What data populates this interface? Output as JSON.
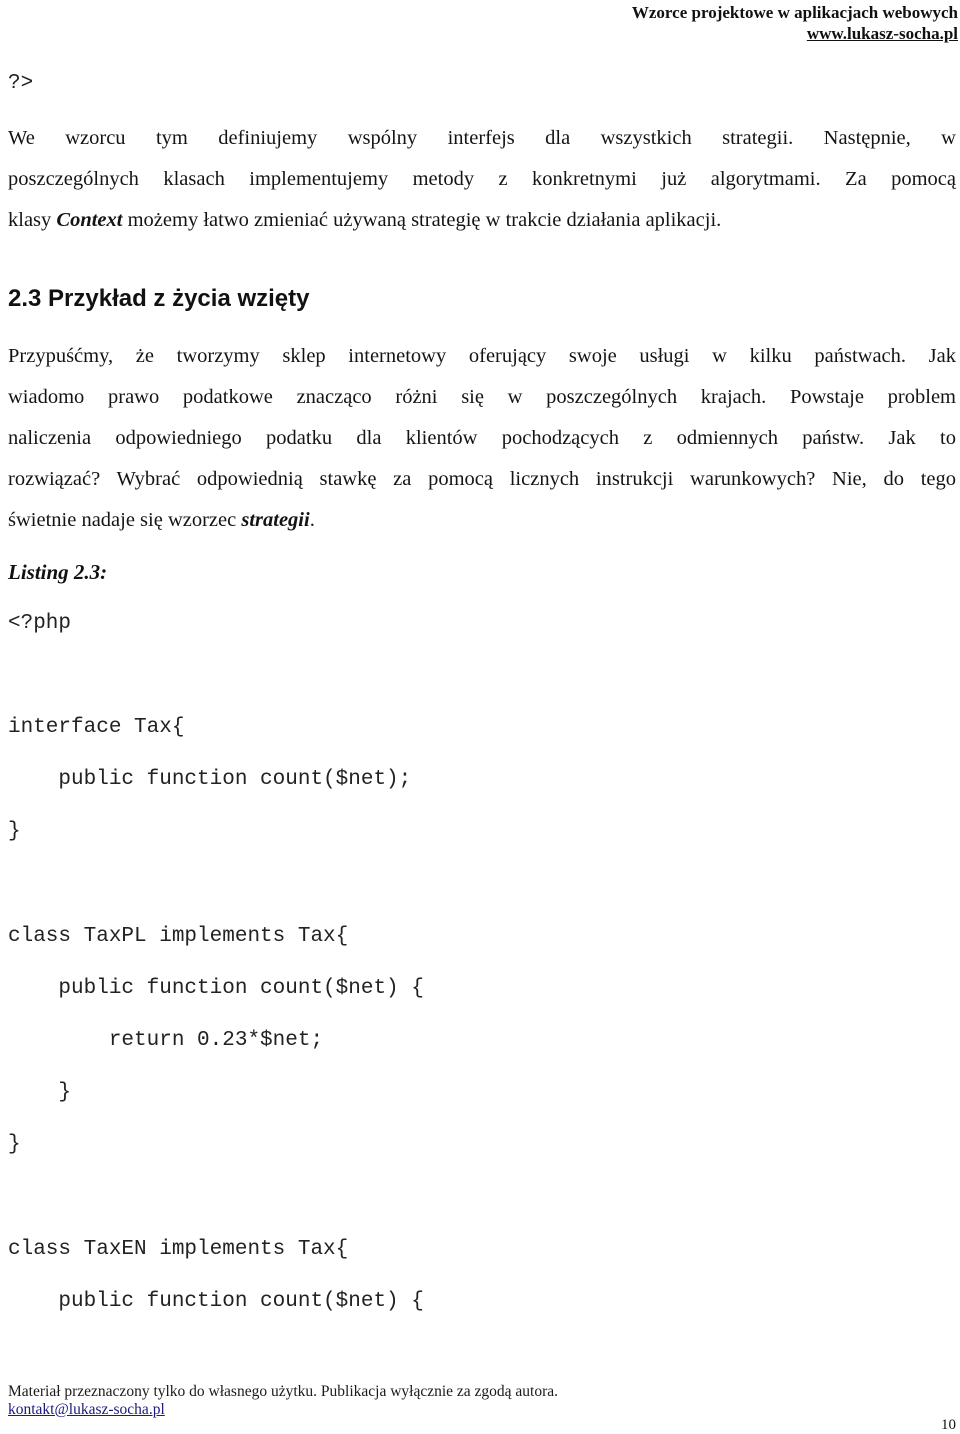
{
  "header": {
    "title": "Wzorce projektowe w aplikacjach webowych",
    "url": "www.lukasz-socha.pl"
  },
  "code_top": {
    "closing_tag": "?>"
  },
  "intro_paragraph": {
    "lines": [
      "We wzorcu tym definiujemy wspólny interfejs dla wszystkich strategii. Następnie, w",
      "poszczególnych klasach implementujemy metody z konkretnymi już algorytmami.  Za pomocą"
    ],
    "line3_before": "klasy ",
    "line3_emph": "Context",
    "line3_after": " możemy łatwo zmieniać używaną strategię w trakcie działania aplikacji."
  },
  "section": {
    "heading": "2.3 Przykład z życia wzięty"
  },
  "example_paragraph": {
    "lines": [
      "Przypuśćmy, że tworzymy sklep internetowy oferujący swoje usługi w kilku państwach. Jak",
      "wiadomo prawo podatkowe znacząco różni się w poszczególnych krajach. Powstaje problem",
      "naliczenia odpowiedniego podatku dla klientów pochodzących z odmiennych państw. Jak to",
      "rozwiązać? Wybrać odpowiednią stawkę za pomocą licznych instrukcji warunkowych? Nie, do tego"
    ],
    "last_before": "świetnie nadaje się wzorzec ",
    "last_emph": "strategii",
    "last_after": "."
  },
  "listing": {
    "label": "Listing 2.3:",
    "code_lines": [
      "<?php",
      "interface Tax{",
      "    public function count($net);",
      "}",
      "class TaxPL implements Tax{",
      "    public function count($net) {",
      "        return 0.23*$net;",
      "    }",
      "}",
      "class TaxEN implements Tax{",
      "    public function count($net) {"
    ]
  },
  "footer": {
    "notice": "Materiał przeznaczony tylko do własnego użytku. Publikacja wyłącznie za zgodą autora.",
    "email": "kontakt@lukasz-socha.pl"
  },
  "page_number": "10"
}
